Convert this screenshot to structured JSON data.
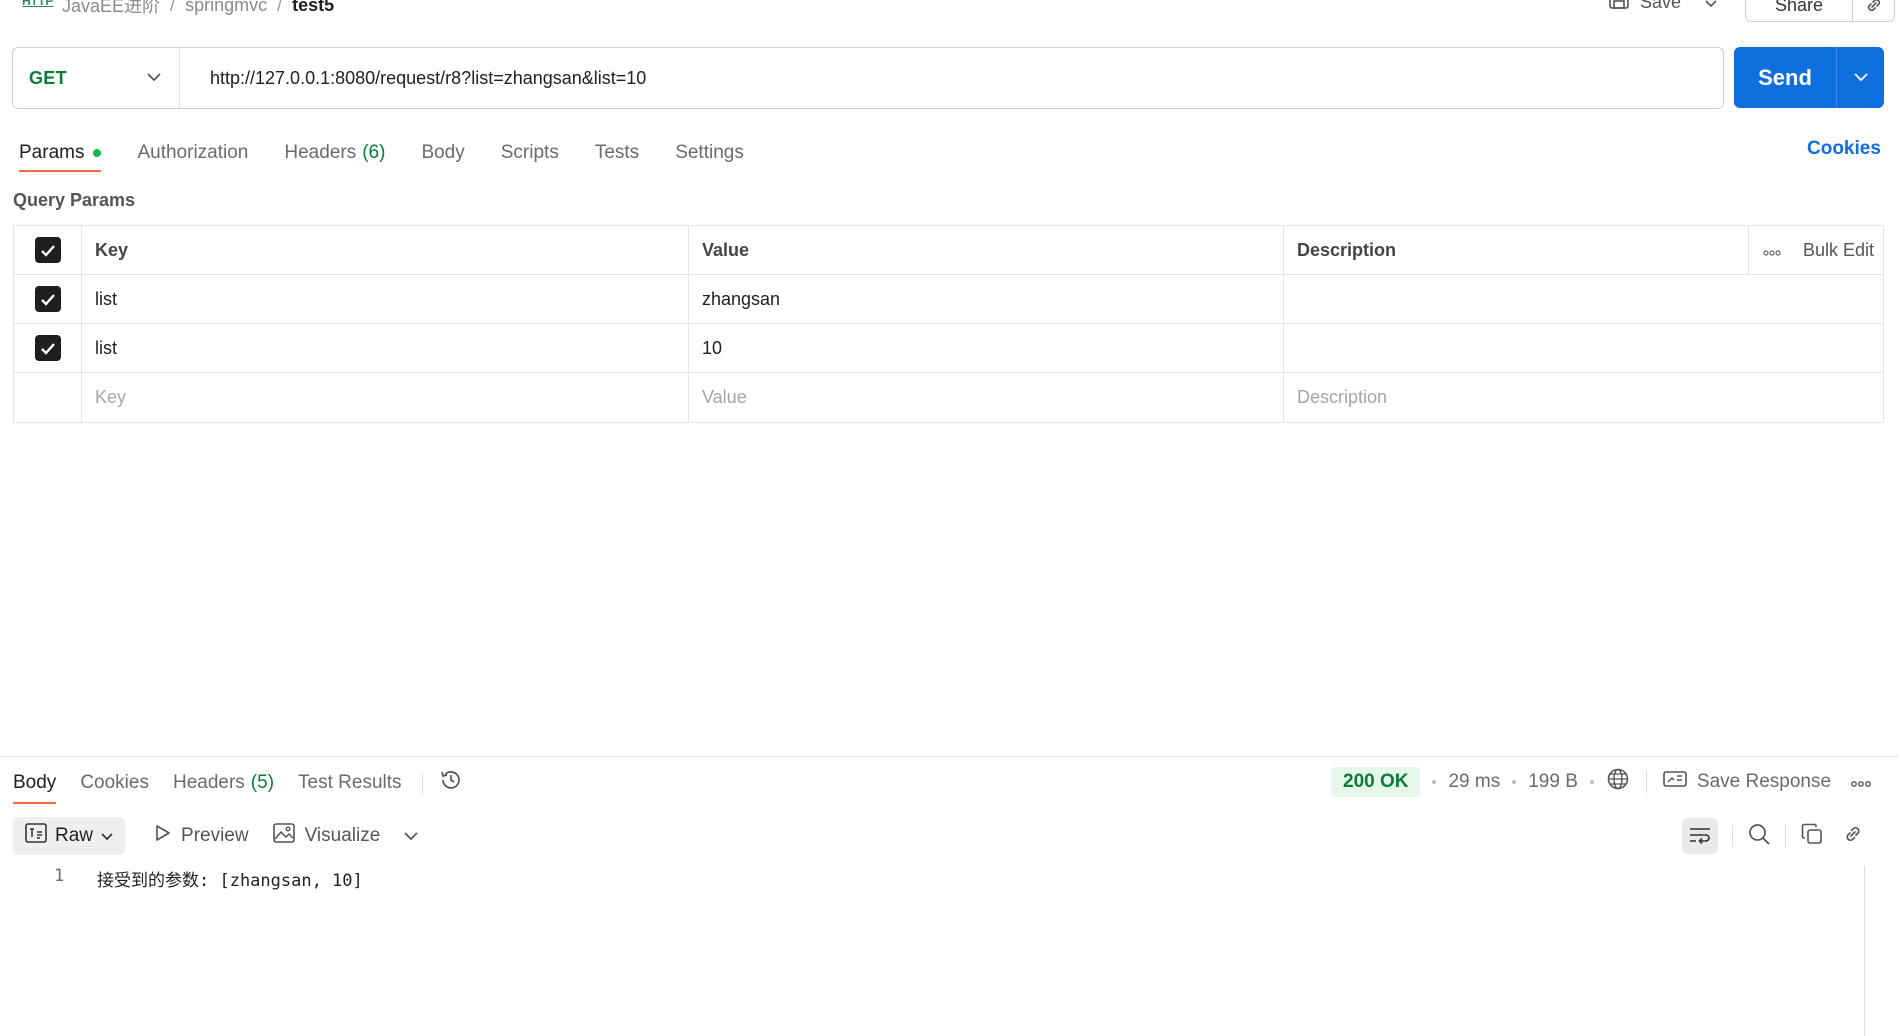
{
  "breadcrumb": {
    "method_badge": "HTTP",
    "items": [
      "JavaEE进阶",
      "springmvc",
      "test5"
    ],
    "separator": "/"
  },
  "top_actions": {
    "save_label": "Save",
    "share_label": "Share"
  },
  "request": {
    "method": "GET",
    "url": "http://127.0.0.1:8080/request/r8?list=zhangsan&list=10",
    "send_label": "Send"
  },
  "request_tabs": [
    {
      "label": "Params",
      "active": true,
      "dot": true
    },
    {
      "label": "Authorization"
    },
    {
      "label": "Headers",
      "count": "(6)"
    },
    {
      "label": "Body"
    },
    {
      "label": "Scripts"
    },
    {
      "label": "Tests"
    },
    {
      "label": "Settings"
    }
  ],
  "cookies_label": "Cookies",
  "query_params": {
    "title": "Query Params",
    "headers": {
      "key": "Key",
      "value": "Value",
      "description": "Description",
      "bulk_edit": "Bulk Edit"
    },
    "rows": [
      {
        "checked": true,
        "key": "list",
        "value": "zhangsan",
        "description": ""
      },
      {
        "checked": true,
        "key": "list",
        "value": "10",
        "description": ""
      }
    ],
    "placeholders": {
      "key": "Key",
      "value": "Value",
      "description": "Description"
    }
  },
  "response": {
    "tabs": [
      {
        "label": "Body",
        "active": true
      },
      {
        "label": "Cookies"
      },
      {
        "label": "Headers",
        "count": "(5)"
      },
      {
        "label": "Test Results"
      }
    ],
    "status": "200 OK",
    "time": "29 ms",
    "size": "199 B",
    "save_response_label": "Save Response",
    "format": "Raw",
    "preview_label": "Preview",
    "visualize_label": "Visualize",
    "lines": [
      {
        "no": "1",
        "text": "接受到的参数: [zhangsan, 10]"
      }
    ]
  },
  "colors": {
    "accent": "#0f6fde",
    "method_green": "#0b7d36",
    "tab_underline": "#f26b3a",
    "status_bg": "#e6f6ea"
  }
}
